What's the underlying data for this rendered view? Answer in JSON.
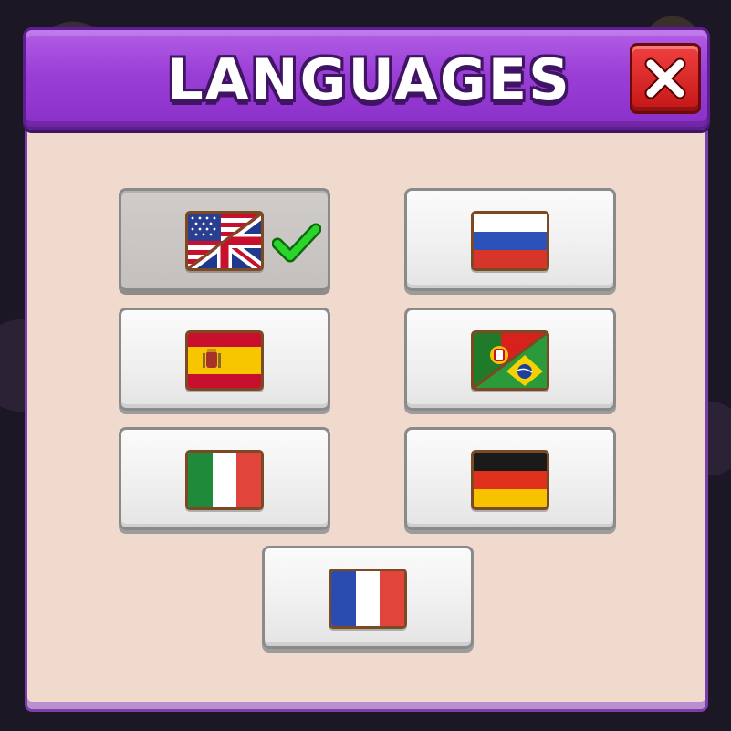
{
  "dialog": {
    "title": "LANGUAGES",
    "close_icon": "close-x-icon"
  },
  "languages": [
    {
      "id": "english",
      "flag": "us-uk-flag-icon",
      "selected": true
    },
    {
      "id": "russian",
      "flag": "russia-flag-icon",
      "selected": false
    },
    {
      "id": "spanish",
      "flag": "spain-flag-icon",
      "selected": false
    },
    {
      "id": "portuguese",
      "flag": "portugal-brazil-flag-icon",
      "selected": false
    },
    {
      "id": "italian",
      "flag": "italy-flag-icon",
      "selected": false
    },
    {
      "id": "german",
      "flag": "germany-flag-icon",
      "selected": false
    },
    {
      "id": "french",
      "flag": "france-flag-icon",
      "selected": false
    }
  ],
  "selected_indicator": "checkmark-icon",
  "colors": {
    "header": "#9a3fd6",
    "panel": "#f0d9cd",
    "close": "#d62020",
    "check": "#22c922"
  }
}
